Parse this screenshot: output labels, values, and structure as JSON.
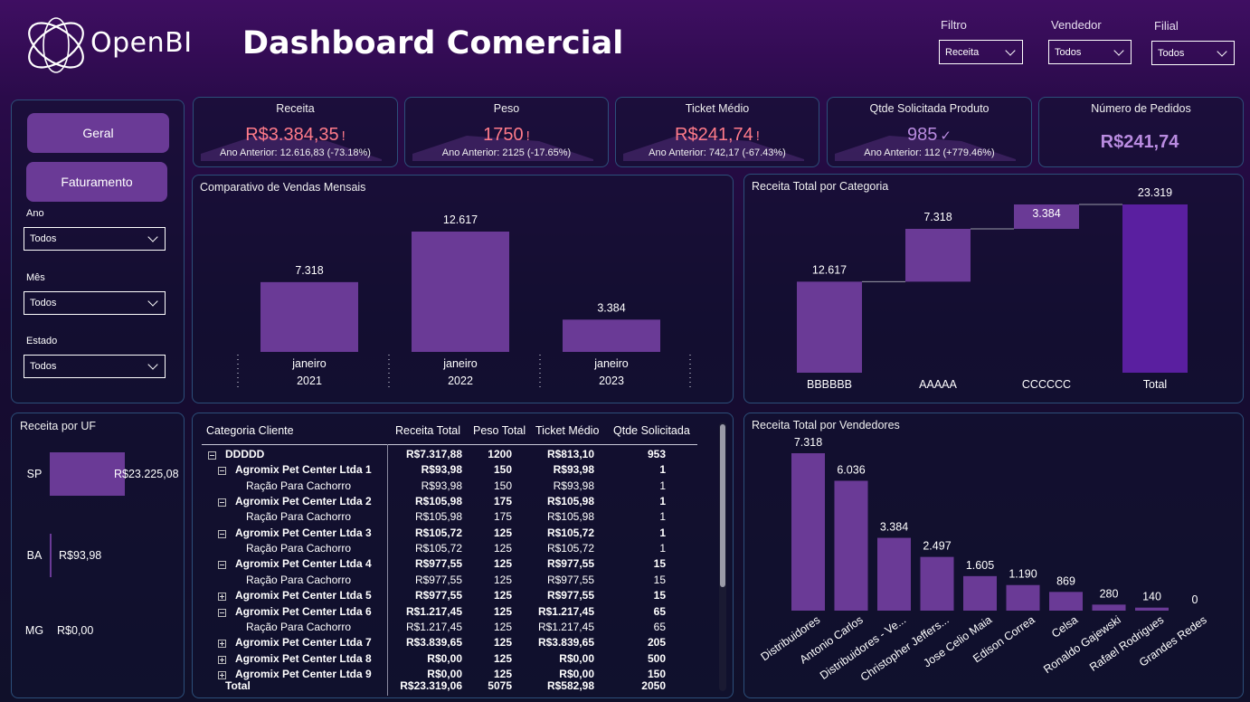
{
  "header": {
    "logo_text": "OpenBI",
    "title": "Dashboard Comercial",
    "filters": [
      {
        "label": "Filtro",
        "value": "Receita"
      },
      {
        "label": "Vendedor",
        "value": "Todos"
      },
      {
        "label": "Filial",
        "value": "Todos"
      }
    ]
  },
  "nav": {
    "buttons": [
      "Geral",
      "Faturamento"
    ],
    "filters": [
      {
        "label": "Ano",
        "value": "Todos"
      },
      {
        "label": "Mês",
        "value": "Todos"
      },
      {
        "label": "Estado",
        "value": "Todos"
      }
    ]
  },
  "kpis": [
    {
      "title": "Receita",
      "value": "R$3.384,35",
      "flag": "!",
      "sub": "Ano Anterior: 12.616,83 (-73.18%)",
      "color": "#ff7b8a"
    },
    {
      "title": "Peso",
      "value": "1750",
      "flag": "!",
      "sub": "Ano Anterior: 2125 (-17.65%)",
      "color": "#ff7b8a"
    },
    {
      "title": "Ticket Médio",
      "value": "R$241,74",
      "flag": "!",
      "sub": "Ano Anterior: 742,17 (-67.43%)",
      "color": "#ff7b8a"
    },
    {
      "title": "Qtde Solicitada Produto",
      "value": "985",
      "flag": "✓",
      "sub": "Ano Anterior: 112 (+779.46%)",
      "color": "#b98be0"
    },
    {
      "title": "Número de Pedidos",
      "value": "R$241,74",
      "flag": "",
      "sub": "",
      "color": "#b98be0"
    }
  ],
  "colors": {
    "bar": "#6a3a96",
    "bar_total": "#5a1fa0",
    "accent_bad": "#ff7b8a",
    "accent_good": "#b98be0"
  },
  "chart_data": [
    {
      "id": "monthly",
      "type": "bar",
      "title": "Comparativo de Vendas Mensais",
      "categories": [
        "janeiro 2021",
        "janeiro 2022",
        "janeiro 2023"
      ],
      "month_labels": [
        "janeiro",
        "janeiro",
        "janeiro"
      ],
      "year_labels": [
        "2021",
        "2022",
        "2023"
      ],
      "values": [
        7318,
        12617,
        3384
      ],
      "value_labels": [
        "7.318",
        "12.617",
        "3.384"
      ],
      "ylim": [
        0,
        12617
      ]
    },
    {
      "id": "waterfall",
      "type": "bar",
      "title": "Receita Total por Categoria",
      "categories": [
        "BBBBBB",
        "AAAAA",
        "CCCCCC",
        "Total"
      ],
      "values": [
        12617,
        7318,
        3384,
        23319
      ],
      "value_labels": [
        "12.617",
        "7.318",
        "3.384",
        "23.319"
      ],
      "ylim": [
        0,
        23319
      ]
    },
    {
      "id": "uf",
      "type": "bar",
      "title": "Receita por UF",
      "categories": [
        "SP",
        "BA",
        "MG"
      ],
      "values": [
        23225.08,
        93.98,
        0
      ],
      "value_labels": [
        "R$23.225,08",
        "R$93,98",
        "R$0,00"
      ]
    },
    {
      "id": "sellers",
      "type": "bar",
      "title": "Receita Total por Vendedores",
      "categories": [
        "Distribuidores",
        "Antonio Carlos",
        "Distribuidores - Ve...",
        "Christopher Jeffers...",
        "Jose Celio Maia",
        "Edison Correa",
        "Celsa",
        "Ronaldo Gajewski",
        "Rafael Rodrigues",
        "Grandes Redes"
      ],
      "values": [
        7318,
        6036,
        3384,
        2497,
        1605,
        1190,
        869,
        280,
        140,
        0
      ],
      "value_labels": [
        "7.318",
        "6.036",
        "3.384",
        "2.497",
        "1.605",
        "1.190",
        "869",
        "280",
        "140",
        "0"
      ],
      "ylim": [
        0,
        7318
      ]
    }
  ],
  "table": {
    "columns": [
      "Categoria Cliente",
      "Receita Total",
      "Peso Total",
      "Ticket Médio",
      "Qtde Solicitada"
    ],
    "rows": [
      {
        "level": 0,
        "exp": "minus",
        "name": "DDDDD",
        "receita": "R$7.317,88",
        "peso": "1200",
        "ticket": "R$813,10",
        "qtde": "953"
      },
      {
        "level": 1,
        "exp": "minus",
        "name": "Agromix Pet Center Ltda 1",
        "receita": "R$93,98",
        "peso": "150",
        "ticket": "R$93,98",
        "qtde": "1"
      },
      {
        "level": 2,
        "exp": "",
        "name": "Ração Para Cachorro",
        "receita": "R$93,98",
        "peso": "150",
        "ticket": "R$93,98",
        "qtde": "1"
      },
      {
        "level": 1,
        "exp": "minus",
        "name": "Agromix Pet Center Ltda 2",
        "receita": "R$105,98",
        "peso": "175",
        "ticket": "R$105,98",
        "qtde": "1"
      },
      {
        "level": 2,
        "exp": "",
        "name": "Ração Para Cachorro",
        "receita": "R$105,98",
        "peso": "175",
        "ticket": "R$105,98",
        "qtde": "1"
      },
      {
        "level": 1,
        "exp": "minus",
        "name": "Agromix Pet Center Ltda 3",
        "receita": "R$105,72",
        "peso": "125",
        "ticket": "R$105,72",
        "qtde": "1"
      },
      {
        "level": 2,
        "exp": "",
        "name": "Ração Para Cachorro",
        "receita": "R$105,72",
        "peso": "125",
        "ticket": "R$105,72",
        "qtde": "1"
      },
      {
        "level": 1,
        "exp": "minus",
        "name": "Agromix Pet Center Ltda 4",
        "receita": "R$977,55",
        "peso": "125",
        "ticket": "R$977,55",
        "qtde": "15"
      },
      {
        "level": 2,
        "exp": "",
        "name": "Ração Para Cachorro",
        "receita": "R$977,55",
        "peso": "125",
        "ticket": "R$977,55",
        "qtde": "15"
      },
      {
        "level": 1,
        "exp": "plus",
        "name": "Agromix Pet Center Ltda 5",
        "receita": "R$977,55",
        "peso": "125",
        "ticket": "R$977,55",
        "qtde": "15"
      },
      {
        "level": 1,
        "exp": "minus",
        "name": "Agromix Pet Center Ltda 6",
        "receita": "R$1.217,45",
        "peso": "125",
        "ticket": "R$1.217,45",
        "qtde": "65"
      },
      {
        "level": 2,
        "exp": "",
        "name": "Ração Para Cachorro",
        "receita": "R$1.217,45",
        "peso": "125",
        "ticket": "R$1.217,45",
        "qtde": "65"
      },
      {
        "level": 1,
        "exp": "plus",
        "name": "Agromix Pet Center Ltda 7",
        "receita": "R$3.839,65",
        "peso": "125",
        "ticket": "R$3.839,65",
        "qtde": "205"
      },
      {
        "level": 1,
        "exp": "plus",
        "name": "Agromix Pet Center Ltda 8",
        "receita": "R$0,00",
        "peso": "125",
        "ticket": "R$0,00",
        "qtde": "500"
      },
      {
        "level": 1,
        "exp": "plus",
        "name": "Agromix Pet Center Ltda 9",
        "receita": "R$0,00",
        "peso": "125",
        "ticket": "R$0,00",
        "qtde": "150"
      }
    ],
    "total": {
      "name": "Total",
      "receita": "R$23.319,06",
      "peso": "5075",
      "ticket": "R$582,98",
      "qtde": "2050"
    }
  }
}
